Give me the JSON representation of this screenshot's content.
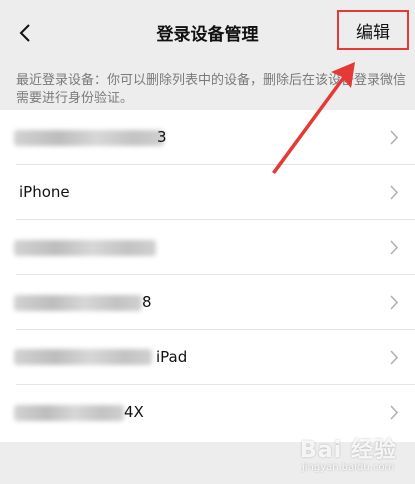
{
  "header": {
    "title": "登录设备管理",
    "edit_label": "编辑",
    "back_icon": "chevron-left-icon"
  },
  "notice": "最近登录设备：你可以删除列表中的设备，删除后在该设备登录微信需要进行身份验证。",
  "devices": [
    {
      "name": "3"
    },
    {
      "name": "iPhone"
    },
    {
      "name": ""
    },
    {
      "name": "8"
    },
    {
      "name": "iPad"
    },
    {
      "name": "4X"
    }
  ],
  "watermark": {
    "brand": "Bai 经验",
    "url": "jingyan.baidu.com"
  },
  "colors": {
    "background": "#ededed",
    "highlight": "#e53935",
    "chevron": "#b2b2b2"
  }
}
